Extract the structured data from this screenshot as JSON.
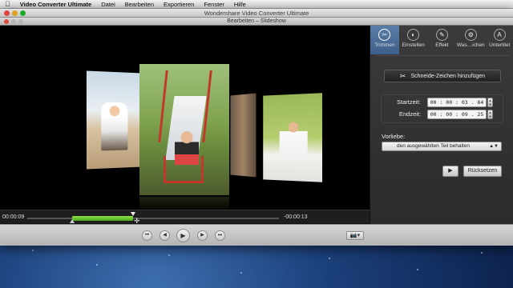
{
  "menubar": {
    "app_name": "Video Converter Ultimate",
    "items": [
      "Datei",
      "Bearbeiten",
      "Exportieren",
      "Fenster",
      "Hilfe"
    ]
  },
  "window": {
    "title": "Wondershare Video Converter Ultimate"
  },
  "editor": {
    "title": "Bearbeiten – Slideshow"
  },
  "timeline": {
    "current_time": "00:00:09",
    "remaining_time": "-00:00:13",
    "progress": 0.35
  },
  "tabs": [
    {
      "label": "Trimmen",
      "icon": "scissors-icon",
      "active": true
    },
    {
      "label": "Einstellen",
      "icon": "adjust-icon",
      "active": false
    },
    {
      "label": "Effekt",
      "icon": "effect-icon",
      "active": false
    },
    {
      "label": "Was…ichen",
      "icon": "watermark-icon",
      "active": false
    },
    {
      "label": "Untertitel",
      "icon": "subtitle-icon",
      "active": false
    }
  ],
  "trim": {
    "add_cut_label": "Schneide-Zeichen hinzufügen",
    "start_label": "Startzeit:",
    "start_value": "00 : 00 : 03 . 84",
    "end_label": "Endzeit:",
    "end_value": "00 : 00 : 09 . 25",
    "preference_label": "Vorliebe:",
    "preference_value": "den ausgewählten Teil behalten",
    "reset_label": "Rücksetzen"
  },
  "colors": {
    "accent": "#4a6d99",
    "progress": "#6cc63a"
  }
}
